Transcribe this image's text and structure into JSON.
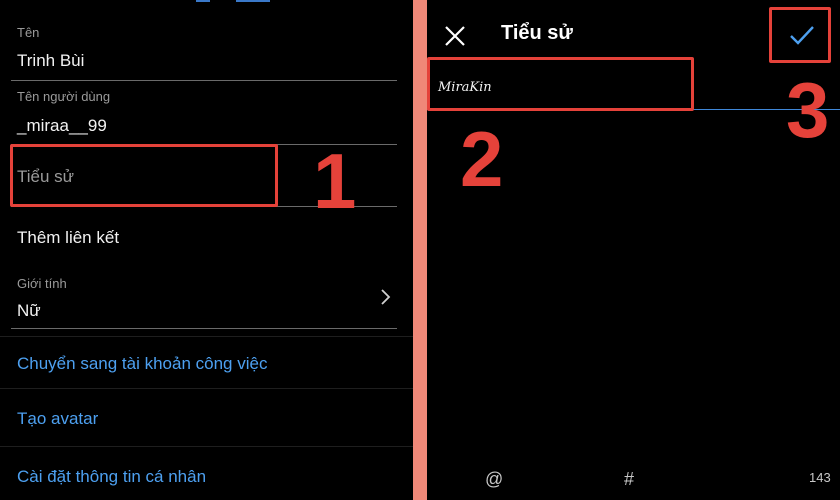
{
  "left": {
    "name_label": "Tên",
    "name_value": "Trinh Bùi",
    "username_label": "Tên người dùng",
    "username_value": "_miraa__99",
    "bio_placeholder": "Tiểu sử",
    "add_link": "Thêm liên kết",
    "gender_label": "Giới tính",
    "gender_value": "Nữ",
    "links": [
      "Chuyển sang tài khoản công việc",
      "Tạo avatar",
      "Cài đặt thông tin cá nhân"
    ]
  },
  "right": {
    "title": "Tiểu sử",
    "bio_text": "MiraKin",
    "bottom_at": "@",
    "bottom_hash": "#",
    "char_count": "143"
  },
  "callouts": {
    "step1": "1",
    "step2": "2",
    "step3": "3"
  },
  "colors": {
    "link": "#4da0f0",
    "callout": "#e5423a",
    "background": "#000000",
    "divider": "#f08878"
  },
  "icons": {
    "close": "close-icon",
    "confirm": "checkmark-icon",
    "chevron": "chevron-right-icon"
  }
}
